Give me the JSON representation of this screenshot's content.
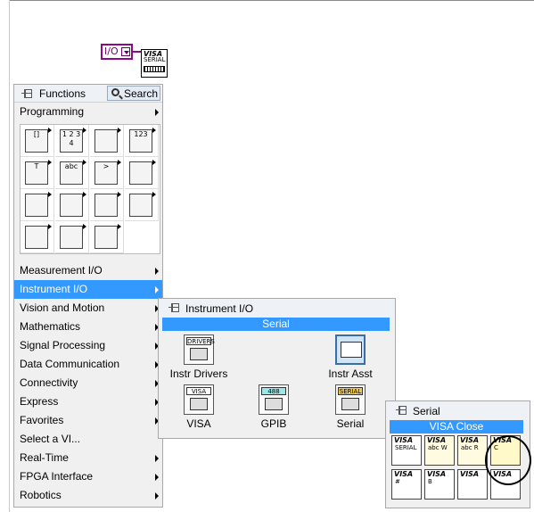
{
  "palette": {
    "title": "Functions",
    "search_label": "Search",
    "categories": [
      {
        "label": "Programming",
        "selected": false
      },
      {
        "label": "Measurement I/O",
        "selected": false
      },
      {
        "label": "Instrument I/O",
        "selected": true
      },
      {
        "label": "Vision and Motion",
        "selected": false
      },
      {
        "label": "Mathematics",
        "selected": false
      },
      {
        "label": "Signal Processing",
        "selected": false
      },
      {
        "label": "Data Communication",
        "selected": false
      },
      {
        "label": "Connectivity",
        "selected": false
      },
      {
        "label": "Express",
        "selected": false
      },
      {
        "label": "Favorites",
        "selected": false
      },
      {
        "label": "Select a VI...",
        "selected": false
      },
      {
        "label": "Real-Time",
        "selected": false
      },
      {
        "label": "FPGA Interface",
        "selected": false
      },
      {
        "label": "Robotics",
        "selected": false
      }
    ],
    "grid_icons": [
      {
        "name": "structures-icon",
        "text": "[]"
      },
      {
        "name": "array-icon",
        "text": "1 2 3 4"
      },
      {
        "name": "cluster-icon",
        "text": ""
      },
      {
        "name": "numeric-icon",
        "text": "123"
      },
      {
        "name": "boolean-icon",
        "text": "T"
      },
      {
        "name": "string-icon",
        "text": "abc"
      },
      {
        "name": "comparison-icon",
        "text": ">"
      },
      {
        "name": "timing-icon",
        "text": ""
      },
      {
        "name": "dialog-icon",
        "text": ""
      },
      {
        "name": "file-io-icon",
        "text": ""
      },
      {
        "name": "waveform-icon",
        "text": ""
      },
      {
        "name": "application-control-icon",
        "text": ""
      },
      {
        "name": "synchronization-icon",
        "text": ""
      },
      {
        "name": "graphics-sound-icon",
        "text": ""
      },
      {
        "name": "report-generation-icon",
        "text": ""
      }
    ]
  },
  "diagram": {
    "control_glyph": "I/O",
    "visa_node_label": "VISA",
    "visa_node_sub": "SERIAL"
  },
  "instrument_io": {
    "title": "Instrument I/O",
    "highlight": "Serial",
    "items": [
      {
        "label": "Instr Drivers",
        "icon_text": "DRIVERS"
      },
      {
        "label": "Instr Asst",
        "icon_text": ""
      },
      {
        "label": "VISA",
        "icon_text": "VISA"
      },
      {
        "label": "GPIB",
        "icon_text": "488"
      },
      {
        "label": "Serial",
        "icon_text": "SERIAL"
      }
    ]
  },
  "serial": {
    "title": "Serial",
    "highlight": "VISA Close",
    "items": [
      {
        "name": "visa-configure-serial-port-icon",
        "top": "VISA",
        "sub": "SERIAL"
      },
      {
        "name": "visa-write-icon",
        "top": "VISA",
        "sub": "abc W"
      },
      {
        "name": "visa-read-icon",
        "top": "VISA",
        "sub": "abc R"
      },
      {
        "name": "visa-close-icon",
        "top": "VISA",
        "sub": "C"
      },
      {
        "name": "visa-bytes-at-port-icon",
        "top": "VISA",
        "sub": "#"
      },
      {
        "name": "visa-serial-break-icon",
        "top": "VISA",
        "sub": "B"
      },
      {
        "name": "visa-set-buffer-size-icon",
        "top": "VISA",
        "sub": ""
      },
      {
        "name": "visa-flush-buffer-icon",
        "top": "VISA",
        "sub": ""
      }
    ]
  },
  "colors": {
    "selection": "#3399ff",
    "control_border": "#8a0a8a",
    "palette_bg": "#f0f0f0"
  }
}
